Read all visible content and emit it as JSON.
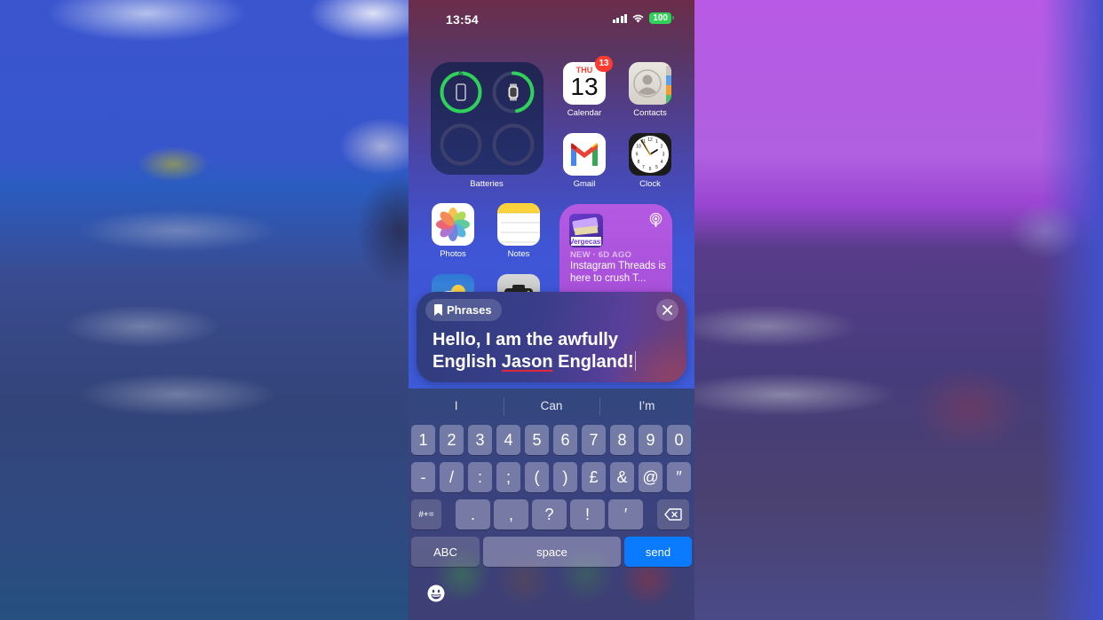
{
  "status_bar": {
    "time": "13:54",
    "battery_level": "100",
    "icons": [
      "signal-icon",
      "wifi-icon",
      "battery-icon"
    ]
  },
  "home_screen": {
    "batteries_widget": {
      "label": "Batteries",
      "devices": [
        {
          "icon": "iphone-icon",
          "charging": true,
          "level": 1.0
        },
        {
          "icon": "apple-watch-icon",
          "charging": false,
          "level": 0.55
        },
        {
          "icon": "empty-slot",
          "level": 0
        },
        {
          "icon": "empty-slot",
          "level": 0
        }
      ]
    },
    "apps": [
      {
        "name": "calendar",
        "label": "Calendar",
        "day": "THU",
        "date": "13",
        "badge": "13"
      },
      {
        "name": "contacts",
        "label": "Contacts"
      },
      {
        "name": "gmail",
        "label": "Gmail"
      },
      {
        "name": "clock",
        "label": "Clock"
      },
      {
        "name": "photos",
        "label": "Photos"
      },
      {
        "name": "notes",
        "label": "Notes"
      }
    ],
    "podcast_widget": {
      "show": "Vergecast",
      "meta": "NEW · 6D AGO",
      "title": "Instagram Threads is here to crush T..."
    }
  },
  "phrases_panel": {
    "chip_label": "Phrases",
    "text_part1": "Hello, I am the awfully English ",
    "text_misspelled": "Jason",
    "text_part2": " England!"
  },
  "keyboard": {
    "suggestions": [
      "I",
      "Can",
      "I’m"
    ],
    "row1": [
      "1",
      "2",
      "3",
      "4",
      "5",
      "6",
      "7",
      "8",
      "9",
      "0"
    ],
    "row2": [
      "-",
      "/",
      ":",
      ";",
      "(",
      ")",
      "£",
      "&",
      "@",
      "″"
    ],
    "row3_mode": "#+=",
    "row3": [
      ".",
      ",",
      "?",
      "!",
      "′"
    ],
    "abc_label": "ABC",
    "space_label": "space",
    "send_label": "send"
  },
  "colors": {
    "send_button": "#0a7aff",
    "battery_green": "#30d158",
    "badge_red": "#ff3b30"
  }
}
